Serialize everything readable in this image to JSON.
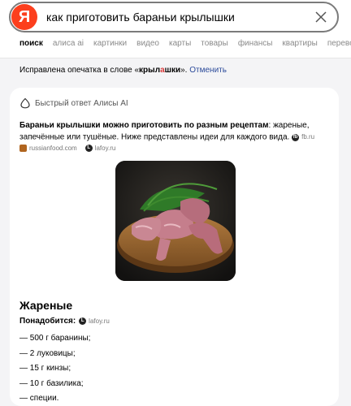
{
  "search": {
    "logo_letter": "Я",
    "query": "как приготовить бараньи крылышки"
  },
  "tabs": [
    "поиск",
    "алиса ai",
    "картинки",
    "видео",
    "карты",
    "товары",
    "финансы",
    "квартиры",
    "переводчик"
  ],
  "spelling": {
    "prefix": "Исправлена опечатка в слове «",
    "word_start": "крыл",
    "word_highlight": "а",
    "word_end": "шки",
    "suffix": "».",
    "cancel_link": "Отменить"
  },
  "alice": {
    "label": "Быстрый ответ Алисы AI"
  },
  "answer": {
    "bold": "Бараньи крылышки можно приготовить по разным рецептам",
    "rest": ": жареные, запечённые или тушёные. Ниже представлены идеи для каждого вида.",
    "inline_source": "fb.ru",
    "sources": [
      {
        "name": "russianfood.com"
      },
      {
        "name": "lafoy.ru"
      }
    ]
  },
  "section": {
    "title": "Жареные",
    "needs_label": "Понадобится:",
    "needs_source": "lafoy.ru",
    "ingredients": [
      "— 500 г баранины;",
      "— 2 луковицы;",
      "— 15 г кинзы;",
      "— 10 г базилика;",
      "— специи."
    ]
  },
  "colors": {
    "logo": "#fc3f1d",
    "link": "#2b4a9a",
    "highlight": "#d93a3a"
  }
}
